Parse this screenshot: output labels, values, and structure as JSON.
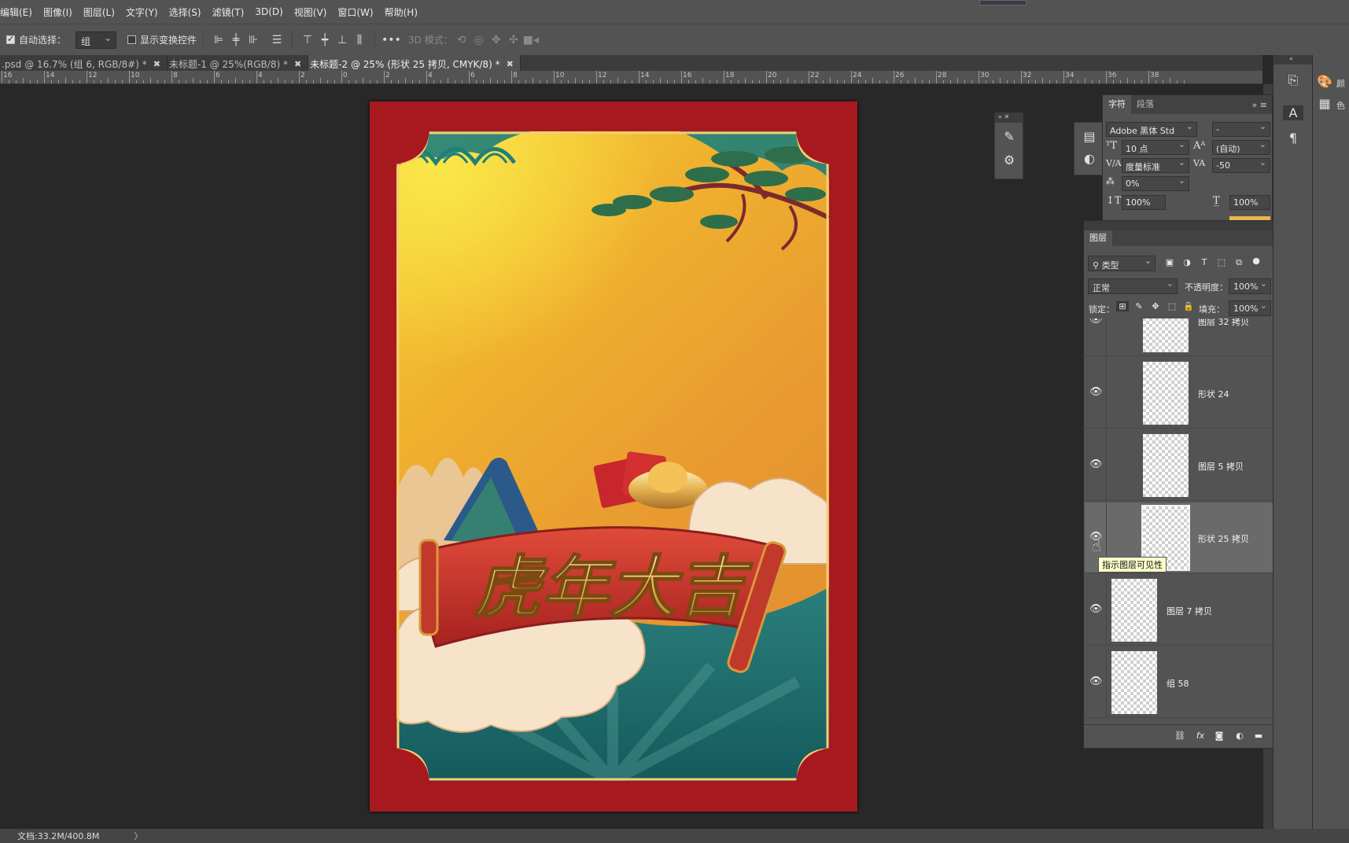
{
  "menu": [
    "编辑(E)",
    "图像(I)",
    "图层(L)",
    "文字(Y)",
    "选择(S)",
    "滤镜(T)",
    "3D(D)",
    "视图(V)",
    "窗口(W)",
    "帮助(H)"
  ],
  "options": {
    "auto_select_label": "自动选择：",
    "auto_select_value": "组",
    "show_transform_label": "显示变换控件",
    "mode_3d_label": "3D 模式："
  },
  "tabs": [
    {
      "label": ".psd @ 16.7% (组 6, RGB/8#) *",
      "active": false
    },
    {
      "label": "未标题-1 @ 25%(RGB/8) *",
      "active": false
    },
    {
      "label": "未标题-2 @ 25% (形状 25 拷贝, CMYK/8) *",
      "active": true
    }
  ],
  "ruler_labels": [
    "16",
    "14",
    "12",
    "10",
    "8",
    "6",
    "4",
    "2",
    "0",
    "2",
    "4",
    "6",
    "8",
    "10",
    "12",
    "14",
    "16",
    "18",
    "20",
    "22",
    "24",
    "26",
    "28",
    "30",
    "32",
    "34",
    "36",
    "38"
  ],
  "character_panel": {
    "tabs": [
      "字符",
      "段落"
    ],
    "font_family": "Adobe 黑体 Std",
    "font_style": "-",
    "font_size": "10 点",
    "leading": "(自动)",
    "kerning": "度量标准",
    "tracking": "-50",
    "baseline_scale": "0%",
    "vertical_scale": "100%",
    "horizontal_scale": "100%"
  },
  "layers_panel": {
    "title": "图层",
    "filter_kind": "类型",
    "blend_mode": "正常",
    "opacity_label": "不透明度：",
    "opacity_value": "100%",
    "lock_label": "锁定：",
    "fill_label": "填充：",
    "fill_value": "100%",
    "layers": [
      {
        "name": "图层 32 拷贝",
        "selected": false,
        "indented": true,
        "linked": false,
        "locked": true
      },
      {
        "name": "形状 24",
        "selected": false,
        "indented": true,
        "linked": false,
        "locked": true
      },
      {
        "name": "图层 5 拷贝",
        "selected": false,
        "indented": true,
        "linked": true,
        "locked": true
      },
      {
        "name": "形状 25 拷贝",
        "selected": true,
        "indented": true,
        "linked": true,
        "locked": true
      },
      {
        "name": "图层 7 拷贝",
        "selected": false,
        "indented": false,
        "linked": false,
        "locked": false
      },
      {
        "name": "组 58",
        "selected": false,
        "indented": false,
        "linked": false,
        "locked": false
      }
    ],
    "tooltip": "指示图层可见性"
  },
  "dock": {
    "label_1": "颜",
    "label_2": "色"
  },
  "status": {
    "doc_size": "文档:33.2M/400.8M"
  },
  "poster": {
    "headline": "虎年大吉"
  },
  "colors": {
    "frame_red": "#a8191f",
    "sky_top": "#f2c22e",
    "sky_bottom": "#e69a2a",
    "sea": "#1f6d6e",
    "cloud": "#f6e3c9",
    "banner_red": "#c8322a",
    "gold": "#f0c86a"
  }
}
